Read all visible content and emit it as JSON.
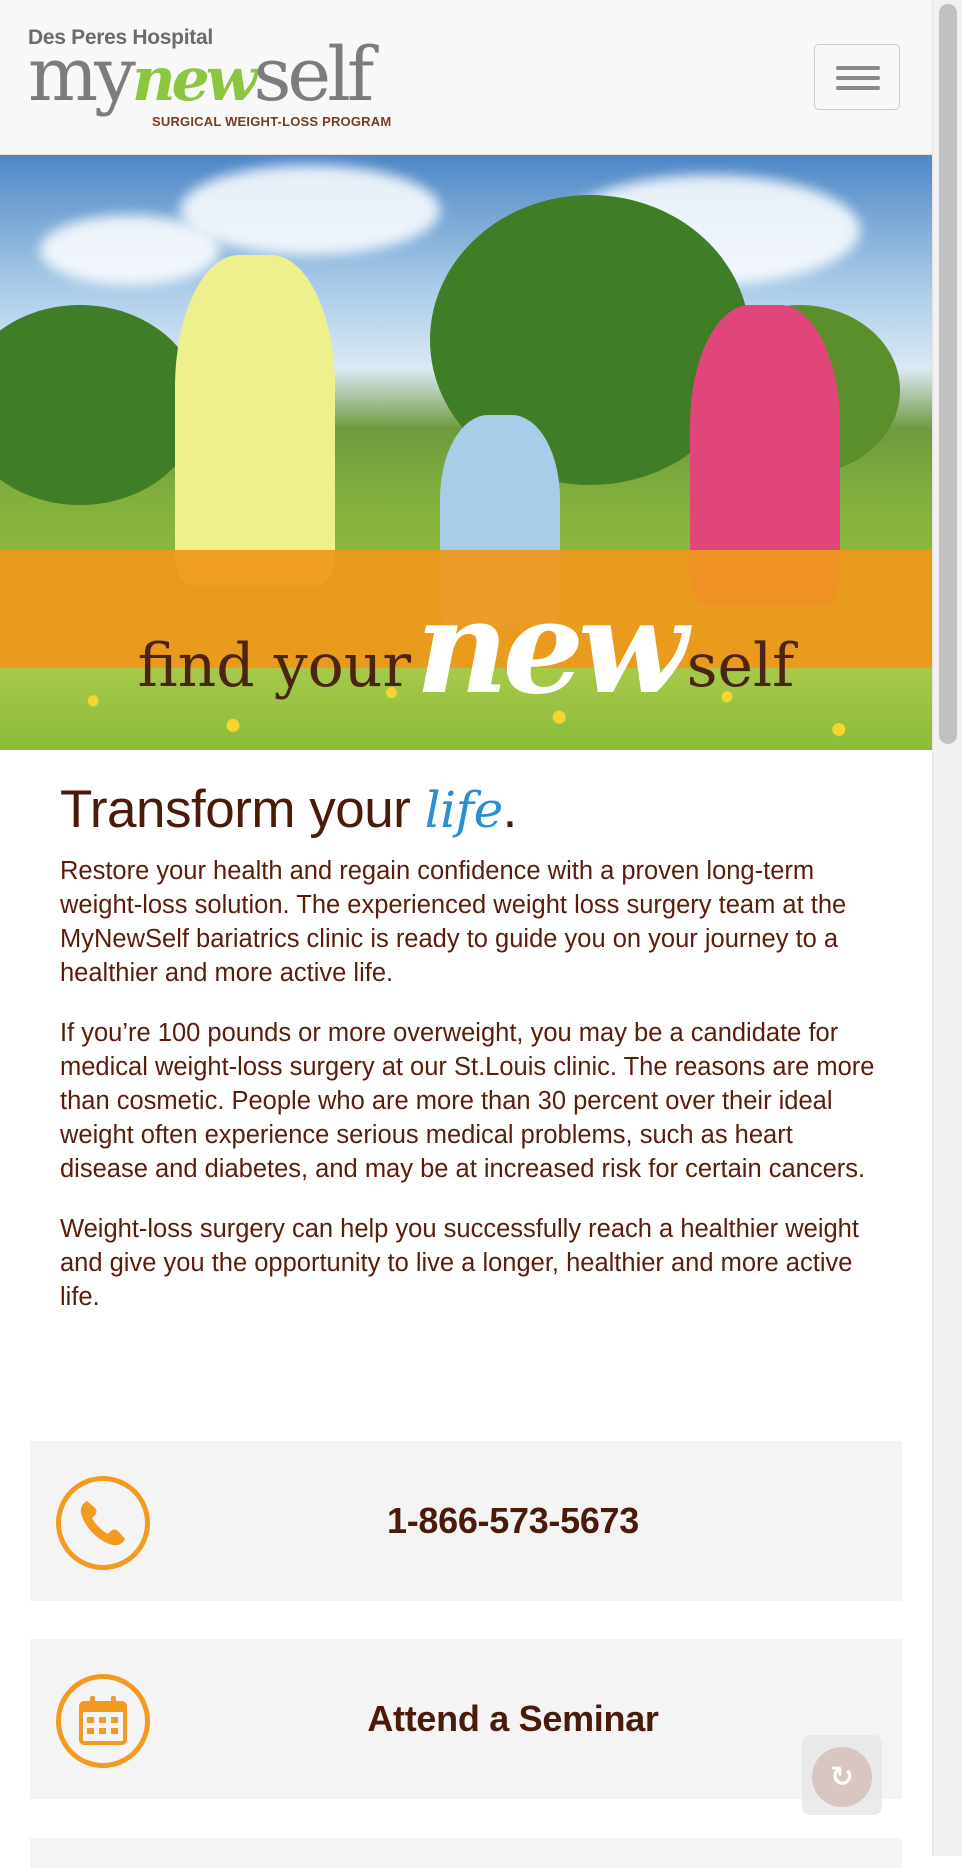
{
  "header": {
    "logo": {
      "hospital": "Des Peres Hospital",
      "brand_pre": "my",
      "brand_accent": "new",
      "brand_post": "self",
      "tagline": "SURGICAL WEIGHT-LOSS PROGRAM"
    },
    "menu_icon": "hamburger-menu-icon"
  },
  "hero": {
    "slogan_start": "find your",
    "slogan_accent": "new",
    "slogan_end": "self"
  },
  "main": {
    "heading_start": "Transform your",
    "heading_accent": "life",
    "heading_end": ".",
    "paragraphs": [
      "Restore your health and regain confidence with a proven long-term weight-loss solution. The experienced weight loss surgery team at the MyNewSelf bariatrics clinic is ready to guide you on your journey to a healthier and more active life.",
      "If you’re 100 pounds or more overweight, you may be a candidate for medical weight-loss surgery at our St.Louis clinic. The reasons are more than cosmetic. People who are more than 30 percent over their ideal weight often experience serious medical problems, such as heart disease and diabetes, and may be at increased risk for certain cancers.",
      "Weight-loss surgery can help you successfully reach a healthier weight and give you the opportunity to live a longer, healthier and more active life."
    ]
  },
  "cta": {
    "phone": {
      "label": "1-866-573-5673",
      "icon": "phone-icon"
    },
    "seminar": {
      "label": "Attend a Seminar",
      "icon": "calendar-icon"
    }
  },
  "scroll_top": {
    "icon": "scroll-to-top-icon"
  },
  "colors": {
    "accent_orange": "#f29a22",
    "text_brown": "#5a1d0c",
    "life_blue": "#2a8fd0",
    "logo_green": "#8cc63f"
  }
}
